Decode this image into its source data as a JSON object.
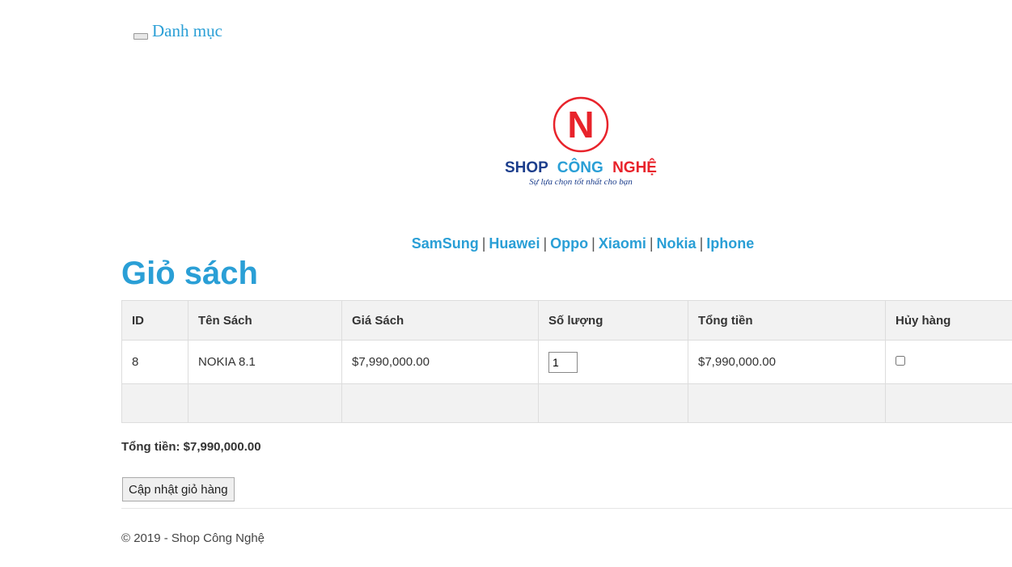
{
  "menu": {
    "label": "Danh mục"
  },
  "logo": {
    "letter": "N",
    "brand_shop": "SHOP",
    "brand_cong": "CÔNG",
    "brand_nghe": "NGHỆ",
    "tagline": "Sự lựa chọn tốt nhất cho bạn",
    "colors": {
      "red": "#e8232b",
      "navy": "#1c3e8c"
    }
  },
  "nav": {
    "items": [
      "SamSung",
      "Huawei",
      "Oppo",
      "Xiaomi",
      "Nokia",
      "Iphone"
    ],
    "separator": "|"
  },
  "page_title": "Giỏ sách",
  "table": {
    "headers": [
      "ID",
      "Tên Sách",
      "Giá Sách",
      "Số lượng",
      "Tổng tiền",
      "Hủy hàng"
    ],
    "rows": [
      {
        "id": "8",
        "name": "NOKIA 8.1",
        "price": "$7,990,000.00",
        "quantity": "1",
        "total": "$7,990,000.00",
        "cancel": false
      }
    ]
  },
  "cart_total": "Tổng tiền: $7,990,000.00",
  "update_button": "Cập nhật giỏ hàng",
  "footer": "© 2019 - Shop Công Nghệ",
  "accent_color": "#2a9fd6"
}
